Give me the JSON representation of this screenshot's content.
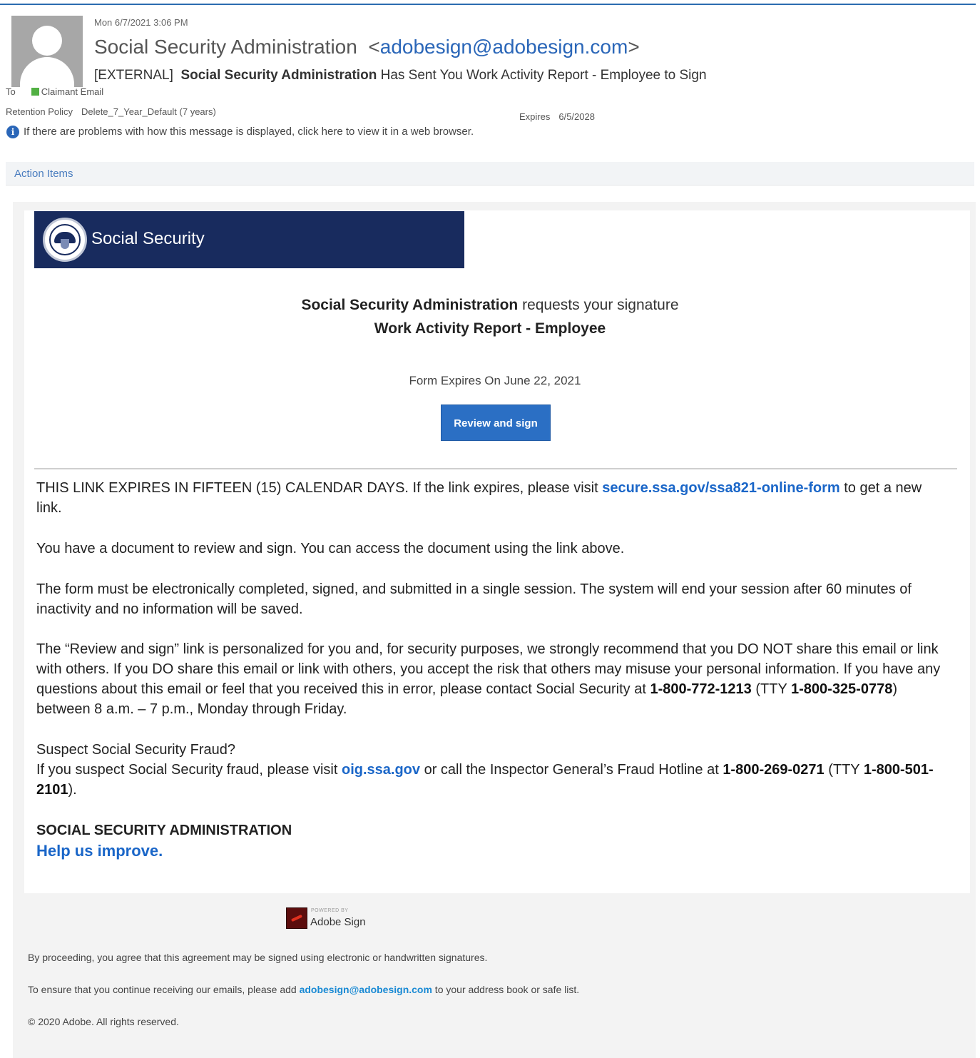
{
  "header": {
    "datetime": "Mon 6/7/2021 3:06 PM",
    "sender_name": "Social Security Administration",
    "sender_email": "adobesign@adobesign.com",
    "subject_tag": "[EXTERNAL]",
    "subject_sender": "Social Security Administration",
    "subject_rest": "Has Sent You Work Activity Report - Employee to Sign",
    "to_label": "To",
    "to_value": "Claimant Email",
    "retention_label": "Retention Policy",
    "retention_value": "Delete_7_Year_Default (7 years)",
    "expires_label": "Expires",
    "expires_value": "6/5/2028",
    "info_text": "If there are problems with how this message is displayed, click here to view it in a web browser.",
    "action_items": "Action Items"
  },
  "banner": {
    "title": "Social Security"
  },
  "request": {
    "sender": "Social Security Administration",
    "rest": "requests your signature",
    "document": "Work Activity Report - Employee",
    "form_expires": "Form Expires On June 22, 2021",
    "button_label": "Review and sign"
  },
  "body": {
    "p1_a": "THIS LINK EXPIRES IN FIFTEEN (15) CALENDAR DAYS.  If the link expires, please visit ",
    "p1_link": "secure.ssa.gov/ssa821-online-form",
    "p1_b": " to get a new link.",
    "p2": "You have a document to review and sign. You can access the document using the link above.",
    "p3": "The form must be electronically completed, signed, and submitted in a single session. The system will end your session after 60 minutes of inactivity and no information will be saved.",
    "p4_a": "The “Review and sign” link is personalized for you and, for security purposes, we strongly recommend that you DO NOT share this email or link with others. If you DO share this email or link with others, you accept the risk that others may misuse your personal information. If you have any questions about this email or feel that you received this in error, please contact Social Security at ",
    "p4_phone": "1-800-772-1213",
    "p4_b": " (TTY ",
    "p4_tty": "1-800-325-0778",
    "p4_c": ") between 8 a.m. – 7 p.m., Monday through Friday.",
    "p5_title": "Suspect Social Security Fraud?",
    "p5_a": "If you suspect Social Security fraud, please visit ",
    "p5_link": "oig.ssa.gov",
    "p5_b": " or call the Inspector General’s Fraud Hotline at ",
    "p5_phone": "1-800-269-0271",
    "p5_c": " (TTY ",
    "p5_tty": "1-800-501-2101",
    "p5_d": ").",
    "org": "SOCIAL SECURITY ADMINISTRATION",
    "improve": "Help us improve."
  },
  "footer": {
    "powered_by": "POWERED BY",
    "brand": "Adobe Sign",
    "line1": "By proceeding, you agree that this agreement may be signed using electronic or handwritten signatures.",
    "line2_a": "To ensure that you continue receiving our emails, please add ",
    "line2_link": "adobesign@adobesign.com",
    "line2_b": " to your address book or safe list.",
    "copyright": "© 2020 Adobe. All rights reserved."
  },
  "colors": {
    "banner": "#182b5e",
    "button": "#2b6fc4",
    "link": "#1a66c8",
    "presence": "#52b043"
  }
}
